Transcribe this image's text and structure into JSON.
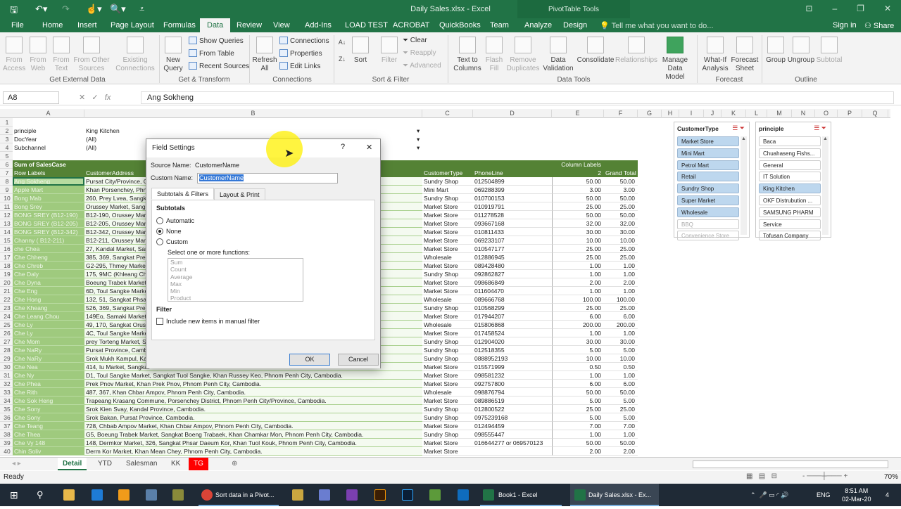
{
  "window": {
    "title": "Daily Sales.xlsx - Excel",
    "context_tab": "PivotTable Tools"
  },
  "quick_access": {
    "save": "save-icon",
    "undo": "undo-icon",
    "redo": "redo-icon",
    "touch": "touch-mode-icon",
    "preview": "print-preview-icon"
  },
  "tabs": [
    "File",
    "Home",
    "Insert",
    "Page Layout",
    "Formulas",
    "Data",
    "Review",
    "View",
    "Add-Ins",
    "LOAD TEST",
    "ACROBAT",
    "QuickBooks",
    "Team",
    "Analyze",
    "Design"
  ],
  "active_tab": "Data",
  "tell_me": "Tell me what you want to do...",
  "sign_in": "Sign in",
  "share": "Share",
  "ribbon": {
    "get_external": {
      "label": "Get External Data",
      "items": [
        "From Access",
        "From Web",
        "From Text",
        "From Other Sources",
        "Existing Connections"
      ]
    },
    "get_transform": {
      "label": "Get & Transform",
      "new_query": "New Query",
      "items": [
        "Show Queries",
        "From Table",
        "Recent Sources"
      ]
    },
    "connections": {
      "label": "Connections",
      "refresh": "Refresh All",
      "items": [
        "Connections",
        "Properties",
        "Edit Links"
      ]
    },
    "sort_filter": {
      "label": "Sort & Filter",
      "sort": "Sort",
      "filter": "Filter",
      "items": [
        "Clear",
        "Reapply",
        "Advanced"
      ]
    },
    "data_tools": {
      "label": "Data Tools",
      "items": [
        "Text to Columns",
        "Flash Fill",
        "Remove Duplicates",
        "Data Validation",
        "Consolidate",
        "Relationships",
        "Manage Data Model"
      ]
    },
    "forecast": {
      "label": "Forecast",
      "items": [
        "What-If Analysis",
        "Forecast Sheet"
      ]
    },
    "outline": {
      "label": "Outline",
      "items": [
        "Group",
        "Ungroup",
        "Subtotal"
      ]
    }
  },
  "formula_bar": {
    "name_box": "A8",
    "value": "Ang Sokheng"
  },
  "columns": [
    "A",
    "B",
    "C",
    "D",
    "E",
    "F",
    "G",
    "H",
    "I",
    "J",
    "K",
    "L",
    "M",
    "N",
    "O",
    "P",
    "Q"
  ],
  "pivot": {
    "filters": [
      {
        "field": "principle",
        "value": "King Kitchen"
      },
      {
        "field": "DocYear",
        "value": "(All)"
      },
      {
        "field": "Subchannel",
        "value": "(All)"
      }
    ],
    "sum_label": "Sum of SalesCase",
    "column_labels": "Column Labels",
    "headers": [
      "Row Labels",
      "CustomerAddress",
      "CustomerType",
      "PhoneLine",
      "2",
      "Grand Total"
    ],
    "rows": [
      [
        "Ang Sokheng",
        "Pursat City/Province, C",
        "Sundry Shop",
        "012504899",
        "50.00",
        "50.00"
      ],
      [
        "Apple Mart",
        "Khan Porsenchey, Phno",
        "Mini Mart",
        "069288399",
        "3.00",
        "3.00"
      ],
      [
        "Bong Mab",
        "260, Prey Lvea, Sangkat",
        "Sundry Shop",
        "010700153",
        "50.00",
        "50.00"
      ],
      [
        "Bong Srey",
        "Orussey Market, Sangk",
        "Market Store",
        "010919791",
        "25.00",
        "25.00"
      ],
      [
        "BONG SREY (B12-190)",
        "B12-190, Orussey Mark",
        "Market Store",
        "011278528",
        "50.00",
        "50.00"
      ],
      [
        "BONG SREY (B12-205)",
        "B12-205, Orussey Mark",
        "Market Store",
        "093667168",
        "32.00",
        "32.00"
      ],
      [
        "BONG SREY (B12-342)",
        "B12-342, Orussey Mark",
        "Market Store",
        "010811433",
        "30.00",
        "30.00"
      ],
      [
        "Channy ( B12-211)",
        "B12-211, Orussey Mark",
        "Market Store",
        "069233107",
        "10.00",
        "10.00"
      ],
      [
        "che Chea",
        "27, Kandal Market, San",
        "Market Store",
        "010547177",
        "25.00",
        "25.00"
      ],
      [
        "Che Chheng",
        "385, 369, Sangkat Prek",
        "Wholesale",
        "012886945",
        "25.00",
        "25.00"
      ],
      [
        "Che Chreb",
        "G2-295, Thmey Market,",
        "Market Store",
        "089428480",
        "1.00",
        "1.00"
      ],
      [
        "Che Daly",
        "175, 9MC (Khleang Chib",
        "Sundry Shop",
        "092862827",
        "1.00",
        "1.00"
      ],
      [
        "Che Dyna",
        "Boeung Trabek Market,",
        "Market Store",
        "098686849",
        "2.00",
        "2.00"
      ],
      [
        "Che Eng",
        "6D, Toul Sangke Market",
        "Market Store",
        "011604470",
        "1.00",
        "1.00"
      ],
      [
        "Che Hong",
        "132, 51, Sangkat Phsar",
        "Wholesale",
        "089666768",
        "100.00",
        "100.00"
      ],
      [
        "Che Kheang",
        "526, 369, Sangkat Prek",
        "Sundry Shop",
        "010568299",
        "25.00",
        "25.00"
      ],
      [
        "Che Leang Chou",
        "149Eo, Samaki Market,",
        "Market Store",
        "017944207",
        "6.00",
        "6.00"
      ],
      [
        "Che Ly",
        "49, 170, Sangkat Oruss",
        "Wholesale",
        "015806868",
        "200.00",
        "200.00"
      ],
      [
        "Che Ly",
        "4C, Toul Sangke Market",
        "Market Store",
        "017458524",
        "1.00",
        "1.00"
      ],
      [
        "Che Mom",
        "prey Torteng Market, S",
        "Sundry Shop",
        "012904020",
        "30.00",
        "30.00"
      ],
      [
        "Che NaRy",
        "Pursat Province, Camb",
        "Sundry Shop",
        "012518355",
        "5.00",
        "5.00"
      ],
      [
        "Che NaRy",
        "Srok Mukh Kampul, Kan",
        "Sundry Shop",
        "0888952193",
        "10.00",
        "10.00"
      ],
      [
        "Che Nea",
        "414, Iu Market, Sangkat",
        "Market Store",
        "015571999",
        "0.50",
        "0.50"
      ],
      [
        "Che Ny",
        "D1, Toul Sangke Market, Sangkat Tuol Sangke, Khan Russey Keo, Phnom Penh City, Cambodia.",
        "Market Store",
        "098581232",
        "1.00",
        "1.00"
      ],
      [
        "Che Phea",
        "Prek Pnov Market, Khan Prek Pnov, Phnom Penh City, Cambodia.",
        "Market Store",
        "092757800",
        "6.00",
        "6.00"
      ],
      [
        "Che Rith",
        "487, 367, Khan Chbar Ampov, Phnom Penh City, Cambodia.",
        "Wholesale",
        "098876794",
        "50.00",
        "50.00"
      ],
      [
        "Che Sok Heng",
        "Trapeang Krasang Commune, Porsenchey District, Phnom Penh City/Province, Cambodia.",
        "Market Store",
        "089886519",
        "5.00",
        "5.00"
      ],
      [
        "Che Sony",
        "Srok Kien Svay, Kandal Province, Cambodia.",
        "Sundry Shop",
        "012800522",
        "25.00",
        "25.00"
      ],
      [
        "Che Sony",
        "Srok Bakan, Pursat Province, Cambodia.",
        "Sundry Shop",
        "0975239168",
        "5.00",
        "5.00"
      ],
      [
        "Che Teang",
        "728, Chbab Ampov Market, Khan Chbar Ampov, Phnom Penh City, Cambodia.",
        "Market Store",
        "012494459",
        "7.00",
        "7.00"
      ],
      [
        "Che Thea",
        "G5, Boeung Trabek Market, Sangkat Boeng Trabaek, Khan Chamkar Mon, Phnom Penh City, Cambodia.",
        "Sundry Shop",
        "098555447",
        "1.00",
        "1.00"
      ],
      [
        "Che Vy 148",
        "148, Dermkor Market, 326, Sangkat Phsar Daeum Kor, Khan Tuol Kouk, Phnom Penh City, Cambodia.",
        "Market Store",
        "016644277 or 069570123",
        "50.00",
        "50.00"
      ],
      [
        "Chin Soliv",
        "Derm Kor Market, Khan Mean Chey, Phnom Penh City, Cambodia.",
        "Market Store",
        "",
        "2.00",
        "2.00"
      ]
    ]
  },
  "slicers": [
    {
      "title": "CustomerType",
      "items": [
        {
          "label": "Market Store",
          "state": "on"
        },
        {
          "label": "Mini Mart",
          "state": "on"
        },
        {
          "label": "Petrol Mart",
          "state": "on"
        },
        {
          "label": "Retail",
          "state": "on"
        },
        {
          "label": "Sundry Shop",
          "state": "on"
        },
        {
          "label": "Super Market",
          "state": "on"
        },
        {
          "label": "Wholesale",
          "state": "on"
        },
        {
          "label": "BBQ",
          "state": "off"
        },
        {
          "label": "Convenience Store",
          "state": "off"
        }
      ]
    },
    {
      "title": "principle",
      "items": [
        {
          "label": "Baca",
          "state": "norm"
        },
        {
          "label": "Chuahaseng Fishs...",
          "state": "norm"
        },
        {
          "label": "General",
          "state": "norm"
        },
        {
          "label": "IT Solution",
          "state": "norm"
        },
        {
          "label": "King Kitchen",
          "state": "on"
        },
        {
          "label": "OKF Distrubution ...",
          "state": "norm"
        },
        {
          "label": "SAMSUNG PHARM",
          "state": "norm"
        },
        {
          "label": "Service",
          "state": "norm"
        },
        {
          "label": "Tofusan Company",
          "state": "norm"
        }
      ]
    }
  ],
  "dialog": {
    "title": "Field Settings",
    "help": "?",
    "close": "✕",
    "source_label": "Source Name:",
    "source_value": "CustomerName",
    "custom_label": "Custom Name:",
    "custom_value": "CustomerName",
    "tabs": [
      "Subtotals & Filters",
      "Layout & Print"
    ],
    "subtotals_heading": "Subtotals",
    "options": [
      "Automatic",
      "None",
      "Custom"
    ],
    "selected": "None",
    "functions_label": "Select one or more functions:",
    "functions": [
      "Sum",
      "Count",
      "Average",
      "Max",
      "Min",
      "Product"
    ],
    "filter_heading": "Filter",
    "include_new": "Include new items in manual filter",
    "include_checked": false,
    "ok": "OK",
    "cancel": "Cancel"
  },
  "sheets": [
    "Detail",
    "YTD",
    "Salesman",
    "KK",
    "TG"
  ],
  "active_sheet": "Detail",
  "status": {
    "ready": "Ready",
    "zoom": "70%"
  },
  "taskbar": {
    "items": [
      "Sort data in a Pivot...",
      "Book1 - Excel",
      "Daily Sales.xlsx - Ex..."
    ],
    "time": "8:51 AM",
    "date": "02-Mar-20",
    "lang": "ENG",
    "notif": "4"
  },
  "colors": {
    "excel_green": "#217346",
    "pivot_header": "#548235",
    "row_label_fill": "#9fca7e",
    "slicer_selected": "#bdd7ee",
    "tab_tg": "#ff0000"
  }
}
